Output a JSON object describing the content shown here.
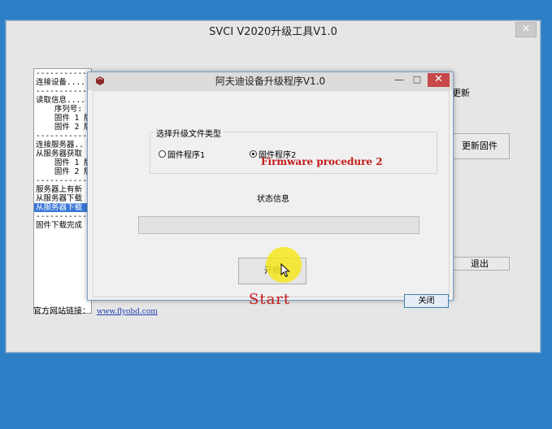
{
  "outer_window": {
    "title": "SVCI V2020升级工具V1.0",
    "close_glyph": "×",
    "log_lines": [
      "--------------",
      "连接设备....",
      "--------------",
      "读取信息....",
      "    序列号: ",
      "    固件 1 版",
      "    固件 2 版",
      "--------------",
      "连接服务器..",
      "从服务器获取",
      "    固件 1 版",
      "    固件 2 版",
      "--------------",
      "服务器上有新",
      "从服务器下载",
      "从服务器下载",
      "--------------",
      "固件下载完成"
    ],
    "selected_log_index": 15,
    "side_label": "更新",
    "update_button_label": "更新固件",
    "exit_button_label": "退出",
    "website_label": "官方网站链接：",
    "website_link": "www.flyobd.com"
  },
  "dialog": {
    "title": "阿夫迪设备升级程序V1.0",
    "min_glyph": "—",
    "max_glyph": "□",
    "close_glyph": "✕",
    "group_label": "选择升级文件类型",
    "radio_options": [
      {
        "label": "固件程序1",
        "checked": false
      },
      {
        "label": "固件程序2",
        "checked": true
      }
    ],
    "status_label": "状态信息",
    "progress": 0,
    "start_button_label": "开始",
    "close_button_label": "关闭"
  },
  "annotations": {
    "firmware_note": "Firmware procedure 2",
    "start_note": "Start"
  },
  "colors": {
    "desktop": "#2d7fc5",
    "annotation_red": "#c41818",
    "cursor_highlight": "#f6e61e",
    "dialog_close": "#c74848"
  }
}
